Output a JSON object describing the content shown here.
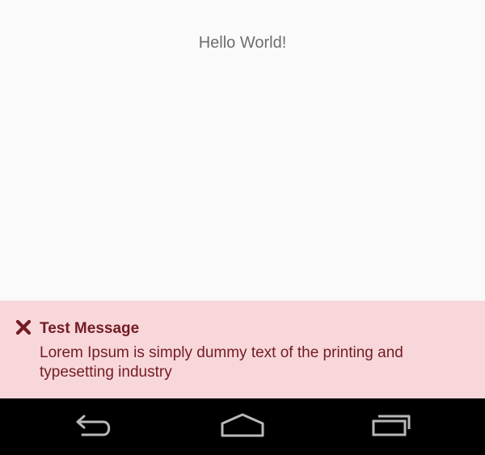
{
  "main": {
    "hello_text": "Hello World!"
  },
  "alert": {
    "title": "Test Message",
    "body": "Lorem Ipsum is simply dummy text of the printing and typesetting industry",
    "close_icon": "close-x-icon",
    "background_color": "#f8d7da",
    "text_color": "#721c24"
  },
  "navbar": {
    "background_color": "#000000",
    "icons": [
      "back-icon",
      "home-icon",
      "recents-icon"
    ]
  }
}
